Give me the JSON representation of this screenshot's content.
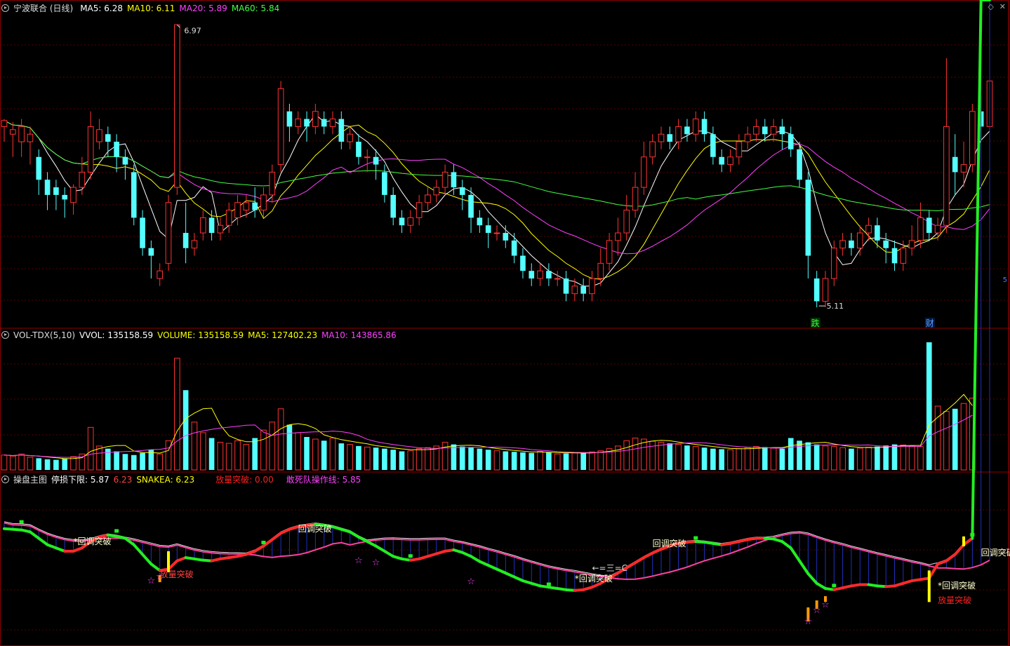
{
  "header": {
    "stock": "宁波联合 (日线)",
    "ma": [
      {
        "label": "MA5: 6.28",
        "color": "#ffffff"
      },
      {
        "label": "MA10: 6.11",
        "color": "#ffff00"
      },
      {
        "label": "MA20: 5.89",
        "color": "#ff40ff"
      },
      {
        "label": "MA60: 5.84",
        "color": "#40ff40"
      }
    ]
  },
  "vol_header": {
    "name": "VOL-TDX(5,10)",
    "items": [
      {
        "label": "VVOL: 135158.59",
        "color": "#ffffff"
      },
      {
        "label": "VOLUME: 135158.59",
        "color": "#ffff00"
      },
      {
        "label": "MA5: 127402.23",
        "color": "#ffff00"
      },
      {
        "label": "MA10: 143865.86",
        "color": "#ff40ff"
      }
    ]
  },
  "ind_header": {
    "name": "操盘主图",
    "items": [
      {
        "label": "停损下限: 5.87",
        "color": "#ffffff"
      },
      {
        "label": "6.23",
        "color": "#ff4040"
      },
      {
        "label": "SNAKEA: 6.23",
        "color": "#ffff00"
      },
      {
        "label": "放量突破: 0.00",
        "color": "#ff2020"
      },
      {
        "label": "敢死队操作线: 5.85",
        "color": "#ff40ff"
      }
    ]
  },
  "icons": [
    "diamond-icon",
    "x-close-icon"
  ],
  "chart_data": {
    "type": "candlestick",
    "price": {
      "candles": [
        [
          6.3,
          6.34,
          6.2,
          6.35
        ],
        [
          6.25,
          6.28,
          6.1,
          6.33
        ],
        [
          6.2,
          6.3,
          6.1,
          6.35
        ],
        [
          6.2,
          6.25,
          6.05,
          6.3
        ],
        [
          6.1,
          5.95,
          5.85,
          6.15
        ],
        [
          5.95,
          5.85,
          5.75,
          6.0
        ],
        [
          5.9,
          5.85,
          5.75,
          5.95
        ],
        [
          5.85,
          5.82,
          5.7,
          5.9
        ],
        [
          5.8,
          5.9,
          5.72,
          5.92
        ],
        [
          5.9,
          6.0,
          5.85,
          6.1
        ],
        [
          6.0,
          6.3,
          5.95,
          6.4
        ],
        [
          6.2,
          6.28,
          6.15,
          6.35
        ],
        [
          6.25,
          6.2,
          6.1,
          6.3
        ],
        [
          6.2,
          6.1,
          6.0,
          6.25
        ],
        [
          6.1,
          6.05,
          5.95,
          6.15
        ],
        [
          6.0,
          5.7,
          5.65,
          6.05
        ],
        [
          5.7,
          5.5,
          5.45,
          5.75
        ],
        [
          5.5,
          5.45,
          5.3,
          5.55
        ],
        [
          5.3,
          5.35,
          5.25,
          5.4
        ],
        [
          5.4,
          5.8,
          5.35,
          5.85
        ],
        [
          5.9,
          6.97,
          5.85,
          6.97
        ],
        [
          5.6,
          5.5,
          5.4,
          5.8
        ],
        [
          5.5,
          5.55,
          5.45,
          5.6
        ],
        [
          5.6,
          5.7,
          5.55,
          5.75
        ],
        [
          5.7,
          5.6,
          5.55,
          5.75
        ],
        [
          5.6,
          5.65,
          5.55,
          5.7
        ],
        [
          5.65,
          5.75,
          5.6,
          5.8
        ],
        [
          5.7,
          5.8,
          5.65,
          5.85
        ],
        [
          5.75,
          5.8,
          5.7,
          5.85
        ],
        [
          5.8,
          5.75,
          5.7,
          5.9
        ],
        [
          5.75,
          5.85,
          5.7,
          5.9
        ],
        [
          5.85,
          6.0,
          5.8,
          6.05
        ],
        [
          6.05,
          6.55,
          6.0,
          6.6
        ],
        [
          6.4,
          6.3,
          6.2,
          6.45
        ],
        [
          6.3,
          6.35,
          6.25,
          6.4
        ],
        [
          6.35,
          6.3,
          6.2,
          6.4
        ],
        [
          6.3,
          6.4,
          6.25,
          6.45
        ],
        [
          6.35,
          6.3,
          6.25,
          6.4
        ],
        [
          6.3,
          6.35,
          6.25,
          6.4
        ],
        [
          6.35,
          6.2,
          6.15,
          6.4
        ],
        [
          6.2,
          6.25,
          6.15,
          6.3
        ],
        [
          6.2,
          6.1,
          6.05,
          6.25
        ],
        [
          6.1,
          6.1,
          6.0,
          6.15
        ],
        [
          6.1,
          6.05,
          5.95,
          6.15
        ],
        [
          6.0,
          5.85,
          5.8,
          6.05
        ],
        [
          5.85,
          5.7,
          5.65,
          5.9
        ],
        [
          5.7,
          5.65,
          5.6,
          5.75
        ],
        [
          5.65,
          5.7,
          5.6,
          5.75
        ],
        [
          5.7,
          5.8,
          5.65,
          5.85
        ],
        [
          5.8,
          5.85,
          5.75,
          5.9
        ],
        [
          5.85,
          5.9,
          5.8,
          5.95
        ],
        [
          5.9,
          6.0,
          5.85,
          6.05
        ],
        [
          6.0,
          5.9,
          5.85,
          6.05
        ],
        [
          5.9,
          5.85,
          5.75,
          5.95
        ],
        [
          5.85,
          5.7,
          5.6,
          5.9
        ],
        [
          5.7,
          5.65,
          5.6,
          5.75
        ],
        [
          5.65,
          5.6,
          5.5,
          5.7
        ],
        [
          5.6,
          5.6,
          5.55,
          5.65
        ],
        [
          5.6,
          5.55,
          5.5,
          5.65
        ],
        [
          5.55,
          5.45,
          5.4,
          5.6
        ],
        [
          5.45,
          5.35,
          5.3,
          5.5
        ],
        [
          5.35,
          5.3,
          5.25,
          5.4
        ],
        [
          5.3,
          5.35,
          5.25,
          5.4
        ],
        [
          5.35,
          5.3,
          5.25,
          5.4
        ],
        [
          5.3,
          5.3,
          5.25,
          5.35
        ],
        [
          5.3,
          5.2,
          5.15,
          5.35
        ],
        [
          5.2,
          5.25,
          5.15,
          5.3
        ],
        [
          5.25,
          5.2,
          5.15,
          5.3
        ],
        [
          5.2,
          5.3,
          5.15,
          5.35
        ],
        [
          5.3,
          5.4,
          5.25,
          5.5
        ],
        [
          5.4,
          5.55,
          5.35,
          5.6
        ],
        [
          5.55,
          5.6,
          5.45,
          5.7
        ],
        [
          5.6,
          5.75,
          5.55,
          5.85
        ],
        [
          5.75,
          5.9,
          5.7,
          6.0
        ],
        [
          5.9,
          6.1,
          5.85,
          6.2
        ],
        [
          6.1,
          6.2,
          6.05,
          6.25
        ],
        [
          6.2,
          6.25,
          6.15,
          6.3
        ],
        [
          6.25,
          6.2,
          6.15,
          6.3
        ],
        [
          6.2,
          6.3,
          6.15,
          6.35
        ],
        [
          6.3,
          6.25,
          6.2,
          6.35
        ],
        [
          6.25,
          6.35,
          6.2,
          6.4
        ],
        [
          6.35,
          6.25,
          6.2,
          6.4
        ],
        [
          6.25,
          6.1,
          6.05,
          6.3
        ],
        [
          6.1,
          6.05,
          6.0,
          6.15
        ],
        [
          6.05,
          6.1,
          6.0,
          6.15
        ],
        [
          6.1,
          6.2,
          6.05,
          6.25
        ],
        [
          6.2,
          6.25,
          6.15,
          6.3
        ],
        [
          6.25,
          6.3,
          6.2,
          6.35
        ],
        [
          6.3,
          6.25,
          6.2,
          6.35
        ],
        [
          6.25,
          6.3,
          6.2,
          6.35
        ],
        [
          6.3,
          6.25,
          6.15,
          6.35
        ],
        [
          6.25,
          6.15,
          6.1,
          6.3
        ],
        [
          6.15,
          5.95,
          5.9,
          6.2
        ],
        [
          5.95,
          5.45,
          5.3,
          6.0
        ],
        [
          5.3,
          5.15,
          5.11,
          5.35
        ],
        [
          5.15,
          5.3,
          5.11,
          5.35
        ],
        [
          5.3,
          5.5,
          5.25,
          5.55
        ],
        [
          5.5,
          5.55,
          5.45,
          5.6
        ],
        [
          5.55,
          5.5,
          5.45,
          5.6
        ],
        [
          5.5,
          5.6,
          5.45,
          5.65
        ],
        [
          5.6,
          5.65,
          5.55,
          5.7
        ],
        [
          5.65,
          5.55,
          5.5,
          5.7
        ],
        [
          5.55,
          5.5,
          5.4,
          5.6
        ],
        [
          5.5,
          5.4,
          5.35,
          5.55
        ],
        [
          5.4,
          5.5,
          5.35,
          5.55
        ],
        [
          5.5,
          5.55,
          5.45,
          5.65
        ],
        [
          5.55,
          5.7,
          5.5,
          5.8
        ],
        [
          5.7,
          5.6,
          5.55,
          5.75
        ],
        [
          5.6,
          5.65,
          5.55,
          5.7
        ],
        [
          5.65,
          6.3,
          5.6,
          6.75
        ],
        [
          6.1,
          6.0,
          5.85,
          6.25
        ],
        [
          6.0,
          6.05,
          5.9,
          6.2
        ],
        [
          6.05,
          6.4,
          6.0,
          6.45
        ],
        [
          6.4,
          6.3,
          6.2,
          6.5
        ],
        [
          6.3,
          6.6,
          6.25,
          6.7
        ]
      ],
      "ma_values": {
        "MA5": 6.28,
        "MA10": 6.11,
        "MA20": 5.89,
        "MA60": 5.84
      },
      "high_label": "6.97",
      "low_label": "5.11",
      "markers": [
        {
          "text": "跌",
          "color": "#40ff40"
        },
        {
          "text": "财",
          "color": "#60a0ff"
        }
      ],
      "side_label": "5"
    },
    "volume": {
      "values": [
        28000,
        26000,
        30000,
        24000,
        22000,
        20000,
        19000,
        21000,
        25000,
        30000,
        80000,
        45000,
        40000,
        35000,
        30000,
        28000,
        32000,
        38000,
        30000,
        55000,
        210000,
        150000,
        90000,
        70000,
        60000,
        52000,
        50000,
        55000,
        48000,
        60000,
        75000,
        90000,
        115000,
        85000,
        70000,
        62000,
        58000,
        55000,
        60000,
        50000,
        48000,
        45000,
        43000,
        42000,
        40000,
        38000,
        35000,
        36000,
        40000,
        42000,
        45000,
        52000,
        48000,
        44000,
        43000,
        40000,
        38000,
        36000,
        35000,
        34000,
        33000,
        32000,
        35000,
        33000,
        30000,
        31000,
        32000,
        33000,
        34000,
        36000,
        40000,
        45000,
        55000,
        60000,
        58000,
        54000,
        52000,
        50000,
        48000,
        46000,
        44000,
        42000,
        40000,
        39000,
        38000,
        40000,
        42000,
        44000,
        43000,
        41000,
        40000,
        60000,
        55000,
        52000,
        48000,
        45000,
        44000,
        42000,
        40000,
        41000,
        43000,
        44000,
        46000,
        48000,
        47000,
        45000,
        44000,
        240000,
        120000,
        110000,
        115000,
        125000,
        135000
      ]
    },
    "indicator": {
      "labels": [
        "*回调突破",
        "放量突破",
        "回调突破",
        "回调突破",
        "*回调突破",
        "*回调突破",
        "回调突破",
        "放量突破",
        "←=三=C"
      ],
      "snake": [
        6.25,
        6.24,
        6.23,
        6.2,
        6.1,
        6.0,
        5.95,
        5.9,
        5.9,
        5.95,
        6.05,
        6.12,
        6.15,
        6.13,
        6.1,
        6.0,
        5.85,
        5.7,
        5.6,
        5.62,
        5.75,
        5.8,
        5.78,
        5.76,
        5.75,
        5.78,
        5.8,
        5.82,
        5.85,
        5.9,
        5.98,
        6.08,
        6.18,
        6.24,
        6.28,
        6.3,
        6.32,
        6.3,
        6.28,
        6.24,
        6.2,
        6.12,
        6.05,
        5.98,
        5.9,
        5.82,
        5.78,
        5.76,
        5.78,
        5.82,
        5.86,
        5.9,
        5.92,
        5.88,
        5.82,
        5.74,
        5.68,
        5.62,
        5.56,
        5.5,
        5.44,
        5.4,
        5.36,
        5.34,
        5.32,
        5.3,
        5.29,
        5.3,
        5.34,
        5.4,
        5.48,
        5.56,
        5.64,
        5.72,
        5.8,
        5.87,
        5.93,
        5.98,
        6.02,
        6.04,
        6.05,
        6.04,
        6.02,
        6.0,
        6.02,
        6.05,
        6.08,
        6.1,
        6.1,
        6.09,
        6.05,
        5.95,
        5.75,
        5.55,
        5.4,
        5.32,
        5.3,
        5.33,
        5.36,
        5.38,
        5.38,
        5.36,
        5.35,
        5.36,
        5.4,
        5.44,
        5.46,
        5.48,
        5.7,
        5.75,
        5.85,
        6.0,
        6.1
      ]
    }
  }
}
